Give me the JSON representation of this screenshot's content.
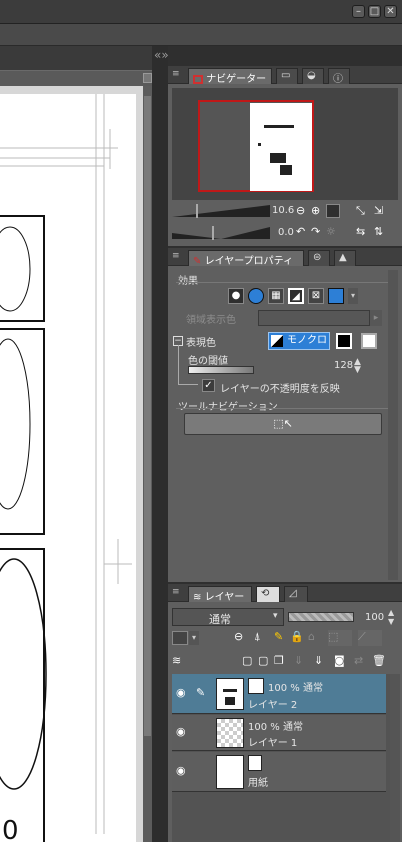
{
  "window": {
    "minimize": "–",
    "maximize": "□",
    "close": "✕"
  },
  "navigator": {
    "tab_label": "ナビゲーター",
    "zoom": "10.6",
    "rotation": "0.0"
  },
  "layer_property": {
    "tab_label": "レイヤープロパティ",
    "effect_label": "効果",
    "area_color_label": "領域表示色",
    "expression_color_label": "表現色",
    "mono_label": "モノクロ",
    "threshold_label": "色の閾値",
    "threshold_value": "128",
    "reflect_opacity_label": "レイヤーの不透明度を反映",
    "reflect_opacity_checked": "✓",
    "tool_nav_label": "ツールナビゲーション"
  },
  "layers": {
    "tab_label": "レイヤー",
    "blend_mode": "通常",
    "opacity": "100",
    "opacity_fraction": 1.0,
    "items": [
      {
        "info": "100 % 通常",
        "name": "レイヤー 2",
        "selected": true
      },
      {
        "info": "100 % 通常",
        "name": "レイヤー 1",
        "selected": false
      },
      {
        "info": "",
        "name": "用紙",
        "selected": false
      }
    ]
  }
}
